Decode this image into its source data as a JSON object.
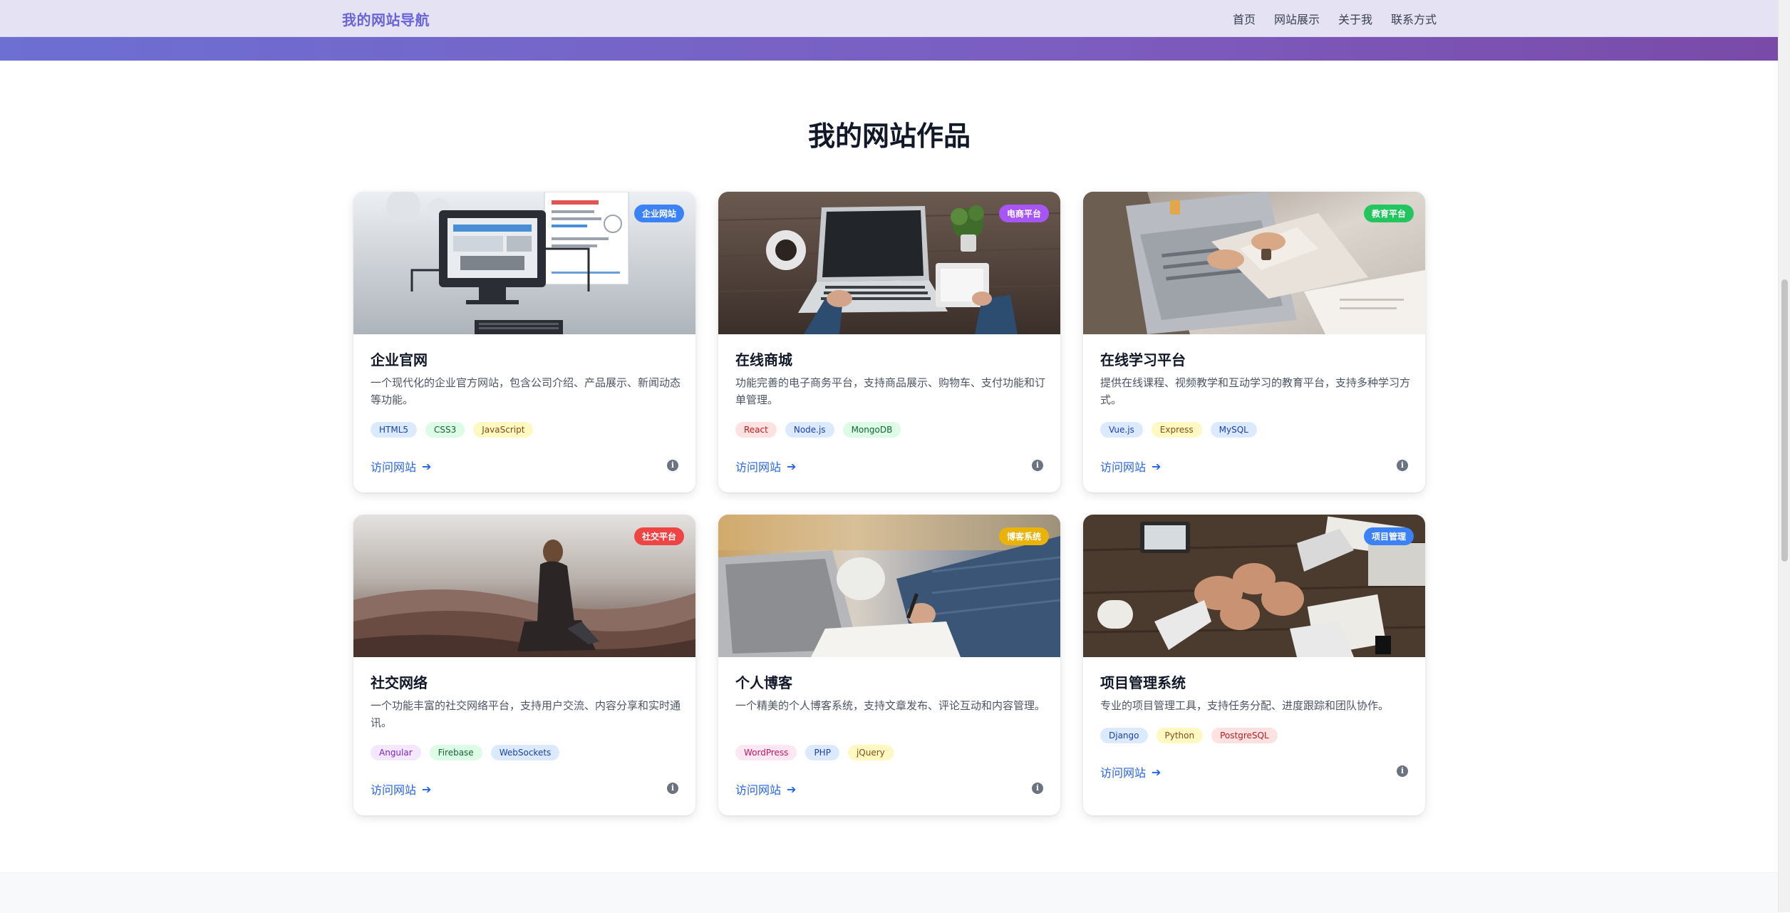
{
  "nav": {
    "brand": "我的网站导航",
    "links": [
      "首页",
      "网站展示",
      "关于我",
      "联系方式"
    ]
  },
  "section": {
    "title": "我的网站作品"
  },
  "cards": [
    {
      "title": "企业官网",
      "desc": "一个现代化的企业官方网站，包含公司介绍、产品展示、新闻动态等功能。",
      "badge": "企业网站",
      "badge_color": "#3b82f6",
      "tags": [
        "HTML5",
        "CSS3",
        "JavaScript"
      ],
      "visit": "访问网站"
    },
    {
      "title": "在线商城",
      "desc": "功能完善的电子商务平台，支持商品展示、购物车、支付功能和订单管理。",
      "badge": "电商平台",
      "badge_color": "#a855f7",
      "tags": [
        "React",
        "Node.js",
        "MongoDB"
      ],
      "visit": "访问网站"
    },
    {
      "title": "在线学习平台",
      "desc": "提供在线课程、视频教学和互动学习的教育平台，支持多种学习方式。",
      "badge": "教育平台",
      "badge_color": "#22c55e",
      "tags": [
        "Vue.js",
        "Express",
        "MySQL"
      ],
      "visit": "访问网站"
    },
    {
      "title": "社交网络",
      "desc": "一个功能丰富的社交网络平台，支持用户交流、内容分享和实时通讯。",
      "badge": "社交平台",
      "badge_color": "#ef4444",
      "tags": [
        "Angular",
        "Firebase",
        "WebSockets"
      ],
      "visit": "访问网站"
    },
    {
      "title": "个人博客",
      "desc": "一个精美的个人博客系统，支持文章发布、评论互动和内容管理。",
      "badge": "博客系统",
      "badge_color": "#eab308",
      "tags": [
        "WordPress",
        "PHP",
        "jQuery"
      ],
      "visit": "访问网站"
    },
    {
      "title": "项目管理系统",
      "desc": "专业的项目管理工具，支持任务分配、进度跟踪和团队协作。",
      "badge": "项目管理",
      "badge_color": "#3b82f6",
      "tags": [
        "Django",
        "Python",
        "PostgreSQL"
      ],
      "visit": "访问网站"
    }
  ],
  "tag_styles": [
    {
      "bg": "#dbeafe",
      "fg": "#1e40af"
    },
    {
      "bg": "#dcfce7",
      "fg": "#166534"
    },
    {
      "bg": "#fef9c3",
      "fg": "#854d0e"
    },
    {
      "bg": "#fee2e2",
      "fg": "#b91c1c"
    },
    {
      "bg": "#f3e8ff",
      "fg": "#7e22ce"
    }
  ]
}
